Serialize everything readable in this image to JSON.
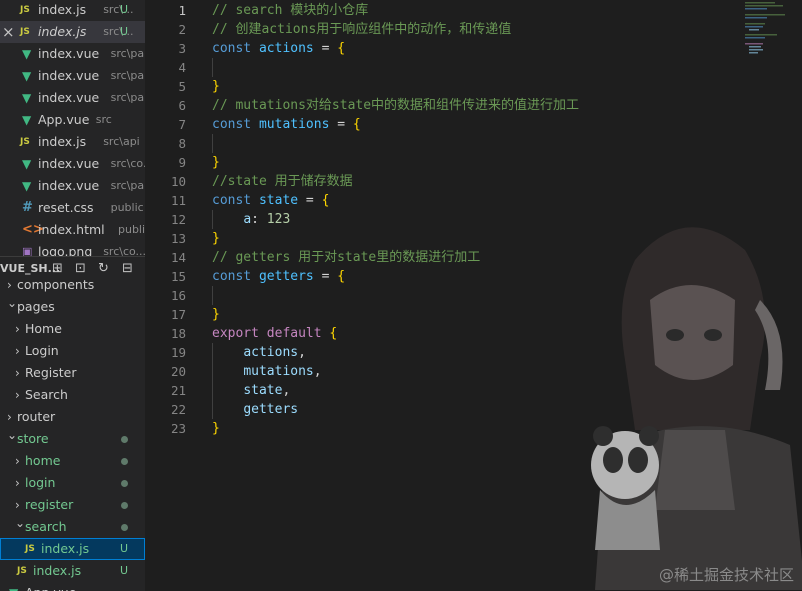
{
  "open_editors": [
    {
      "icon": "JS",
      "name": "index.js",
      "path": "src\\...",
      "status": "U",
      "italic": false
    },
    {
      "icon": "JS",
      "name": "index.js",
      "path": "src\\...",
      "status": "U",
      "italic": true,
      "active": true
    },
    {
      "icon": "V",
      "name": "index.vue",
      "path": "src\\pa...",
      "status": ""
    },
    {
      "icon": "V",
      "name": "index.vue",
      "path": "src\\pa...",
      "status": ""
    },
    {
      "icon": "V",
      "name": "index.vue",
      "path": "src\\pa...",
      "status": ""
    },
    {
      "icon": "V",
      "name": "App.vue",
      "path": "src",
      "status": ""
    },
    {
      "icon": "JS",
      "name": "index.js",
      "path": "src\\api",
      "status": ""
    },
    {
      "icon": "V",
      "name": "index.vue",
      "path": "src\\co...",
      "status": ""
    },
    {
      "icon": "V",
      "name": "index.vue",
      "path": "src\\pa...",
      "status": ""
    },
    {
      "icon": "#",
      "name": "reset.css",
      "path": "public",
      "status": ""
    },
    {
      "icon": "<>",
      "name": "index.html",
      "path": "public",
      "status": ""
    },
    {
      "icon": "▣",
      "name": "logo.png",
      "path": "src\\co...",
      "status": ""
    }
  ],
  "close_glyph": "×",
  "explorer": {
    "title": "VUE_SH...",
    "tools": [
      "⊞",
      "⊡",
      "↻",
      "⊟"
    ]
  },
  "tree": [
    {
      "label": "components",
      "indent": 0,
      "chevron": "›"
    },
    {
      "label": "pages",
      "indent": 0,
      "chevron": "⌄"
    },
    {
      "label": "Home",
      "indent": 1,
      "chevron": "›"
    },
    {
      "label": "Login",
      "indent": 1,
      "chevron": "›"
    },
    {
      "label": "Register",
      "indent": 1,
      "chevron": "›"
    },
    {
      "label": "Search",
      "indent": 1,
      "chevron": "›"
    },
    {
      "label": "router",
      "indent": 0,
      "chevron": "›"
    },
    {
      "label": "store",
      "indent": 0,
      "chevron": "⌄",
      "modified": true
    },
    {
      "label": "home",
      "indent": 1,
      "chevron": "›",
      "modified": true
    },
    {
      "label": "login",
      "indent": 1,
      "chevron": "›",
      "modified": true
    },
    {
      "label": "register",
      "indent": 1,
      "chevron": "›",
      "modified": true
    },
    {
      "label": "search",
      "indent": 1,
      "chevron": "⌄",
      "modified": true
    },
    {
      "label": "index.js",
      "indent": 2,
      "icon": "JS",
      "status": "U",
      "selected": true
    },
    {
      "label": "index.js",
      "indent": 1,
      "icon": "JS",
      "status": "U"
    },
    {
      "label": "App.vue",
      "indent": 0,
      "icon": "V",
      "status": ""
    }
  ],
  "code_lines": [
    {
      "n": "1",
      "tokens": [
        [
          "c-comment",
          "// search 模块的小仓库"
        ]
      ]
    },
    {
      "n": "2",
      "tokens": [
        [
          "c-comment",
          "// 创建actions用于响应组件中的动作，和传递值"
        ]
      ]
    },
    {
      "n": "3",
      "tokens": [
        [
          "c-kw",
          "const "
        ],
        [
          "c-var",
          "actions"
        ],
        [
          "c-plain",
          " = "
        ],
        [
          "c-brace",
          "{"
        ]
      ]
    },
    {
      "n": "4",
      "tokens": []
    },
    {
      "n": "5",
      "tokens": [
        [
          "c-brace",
          "}"
        ]
      ]
    },
    {
      "n": "6",
      "tokens": [
        [
          "c-comment",
          "// mutations对给state中的数据和组件传进来的值进行加工"
        ]
      ]
    },
    {
      "n": "7",
      "tokens": [
        [
          "c-kw",
          "const "
        ],
        [
          "c-var",
          "mutations"
        ],
        [
          "c-plain",
          " = "
        ],
        [
          "c-brace",
          "{"
        ]
      ]
    },
    {
      "n": "8",
      "tokens": []
    },
    {
      "n": "9",
      "tokens": [
        [
          "c-brace",
          "}"
        ]
      ]
    },
    {
      "n": "10",
      "tokens": [
        [
          "c-comment",
          "//state 用于储存数据"
        ]
      ]
    },
    {
      "n": "11",
      "tokens": [
        [
          "c-kw",
          "const "
        ],
        [
          "c-var",
          "state"
        ],
        [
          "c-plain",
          " = "
        ],
        [
          "c-brace",
          "{"
        ]
      ]
    },
    {
      "n": "12",
      "tokens": [
        [
          "c-plain",
          "    "
        ],
        [
          "c-prop",
          "a"
        ],
        [
          "c-plain",
          ": "
        ],
        [
          "c-num",
          "123"
        ]
      ]
    },
    {
      "n": "13",
      "tokens": [
        [
          "c-brace",
          "}"
        ]
      ]
    },
    {
      "n": "14",
      "tokens": [
        [
          "c-comment",
          "// getters 用于对state里的数据进行加工"
        ]
      ]
    },
    {
      "n": "15",
      "tokens": [
        [
          "c-kw",
          "const "
        ],
        [
          "c-var",
          "getters"
        ],
        [
          "c-plain",
          " = "
        ],
        [
          "c-brace",
          "{"
        ]
      ]
    },
    {
      "n": "16",
      "tokens": []
    },
    {
      "n": "17",
      "tokens": [
        [
          "c-brace",
          "}"
        ]
      ]
    },
    {
      "n": "18",
      "tokens": [
        [
          "c-export",
          "export "
        ],
        [
          "c-export",
          "default "
        ],
        [
          "c-brace",
          "{"
        ]
      ]
    },
    {
      "n": "19",
      "tokens": [
        [
          "c-plain",
          "    "
        ],
        [
          "c-prop",
          "actions"
        ],
        [
          "c-plain",
          ","
        ]
      ]
    },
    {
      "n": "20",
      "tokens": [
        [
          "c-plain",
          "    "
        ],
        [
          "c-prop",
          "mutations"
        ],
        [
          "c-plain",
          ","
        ]
      ]
    },
    {
      "n": "21",
      "tokens": [
        [
          "c-plain",
          "    "
        ],
        [
          "c-prop",
          "state"
        ],
        [
          "c-plain",
          ","
        ]
      ]
    },
    {
      "n": "22",
      "tokens": [
        [
          "c-plain",
          "    "
        ],
        [
          "c-prop",
          "getters"
        ]
      ]
    },
    {
      "n": "23",
      "tokens": [
        [
          "c-brace",
          "}"
        ]
      ]
    }
  ],
  "current_line": "1",
  "watermark": "@稀土掘金技术社区",
  "colors": {
    "sidebar_bg": "#252526",
    "editor_bg": "#1e1e1e",
    "selection": "#04395e",
    "untracked": "#73c991",
    "comment": "#6a9955",
    "keyword": "#569cd6"
  }
}
